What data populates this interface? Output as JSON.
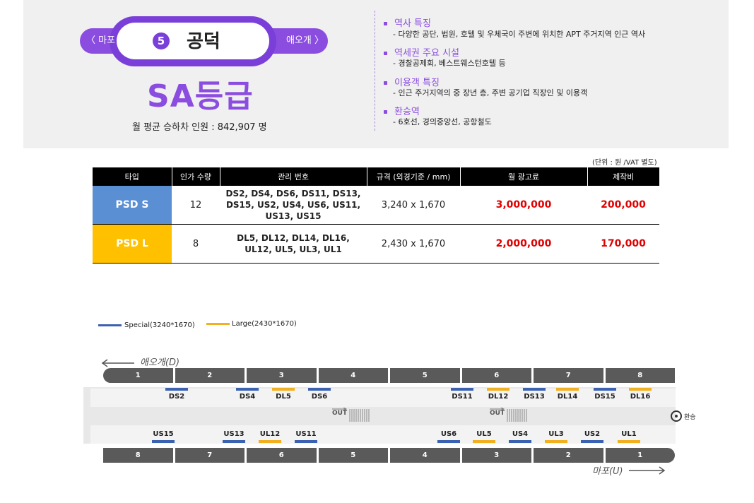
{
  "station": {
    "prev": "〈 마포",
    "next": "애오개 〉",
    "line_number": "5",
    "name": "공덕",
    "grade": "SA등급",
    "passengers": "월 평균 승하차 인원 :  842,907 명"
  },
  "info": [
    {
      "head": "역사 특징",
      "body": "-  다양한 공단, 법원, 호텔 및 우체국이 주변에 위치한 APT 주거지역 인근 역사"
    },
    {
      "head": "역세권 주요 시설",
      "body": "-  경찰공제회, 베스트웨스턴호텔  등"
    },
    {
      "head": "이용객 특징",
      "body": "-  인근 주거지역의 중 장년 층, 주변 공기업 직장인 및 이용객"
    },
    {
      "head": "환승역",
      "body": "-    6호선, 경의중앙선, 공항철도"
    }
  ],
  "table": {
    "unit": "(단위 : 원 /VAT 별도)",
    "headers": [
      "타입",
      "인가 수량",
      "관리 번호",
      "규격 (외경기준 / mm)",
      "월 광고료",
      "제작비"
    ],
    "rows": [
      {
        "type": "PSD S",
        "qty": "12",
        "codes": "DS2, DS4, DS6, DS11, DS13, DS15, US2, US4, US6, US11, US13, US15",
        "size": "3,240 x 1,670",
        "fee": "3,000,000",
        "cost": "200,000",
        "color": "#5b8fd4"
      },
      {
        "type": "PSD L",
        "qty": "8",
        "codes": "DL5, DL12, DL14, DL16, UL12, UL5, UL3, UL1",
        "size": "2,430 x 1,670",
        "fee": "2,000,000",
        "cost": "170,000",
        "color": "#ffc000"
      }
    ]
  },
  "legend": {
    "special": {
      "label": "Special(3240*1670)",
      "color": "#3b62b0"
    },
    "large": {
      "label": "Large(2430*1670)",
      "color": "#f0b020"
    }
  },
  "diagram": {
    "top_direction": "애오개(D)",
    "bottom_direction": "마포(U)",
    "out_label": "OUT",
    "transfer_label": "환승",
    "top_cars": [
      "1",
      "2",
      "3",
      "4",
      "5",
      "6",
      "7",
      "8"
    ],
    "bottom_cars": [
      "8",
      "7",
      "6",
      "5",
      "4",
      "3",
      "2",
      "1"
    ],
    "top_screens": [
      {
        "label": "DS2",
        "kind": "special"
      },
      {
        "label": "DS4",
        "kind": "special"
      },
      {
        "label": "DL5",
        "kind": "large"
      },
      {
        "label": "DS6",
        "kind": "special"
      },
      {
        "label": "DS11",
        "kind": "special"
      },
      {
        "label": "DL12",
        "kind": "large"
      },
      {
        "label": "DS13",
        "kind": "special"
      },
      {
        "label": "DL14",
        "kind": "large"
      },
      {
        "label": "DS15",
        "kind": "special"
      },
      {
        "label": "DL16",
        "kind": "large"
      }
    ],
    "bottom_screens": [
      {
        "label": "US15",
        "kind": "special"
      },
      {
        "label": "US13",
        "kind": "special"
      },
      {
        "label": "UL12",
        "kind": "large"
      },
      {
        "label": "US11",
        "kind": "special"
      },
      {
        "label": "US6",
        "kind": "special"
      },
      {
        "label": "UL5",
        "kind": "large"
      },
      {
        "label": "US4",
        "kind": "special"
      },
      {
        "label": "UL3",
        "kind": "large"
      },
      {
        "label": "US2",
        "kind": "special"
      },
      {
        "label": "UL1",
        "kind": "large"
      }
    ]
  }
}
